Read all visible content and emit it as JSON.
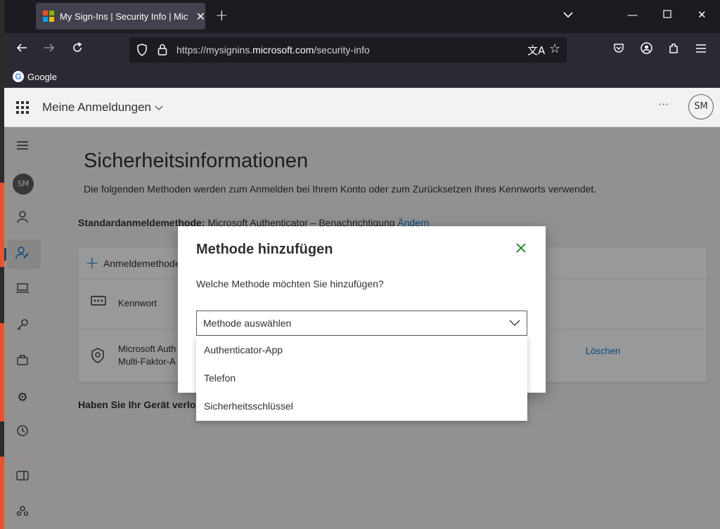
{
  "browser": {
    "tab_title": "My Sign-Ins | Security Info | Mic",
    "url_prefix": "https://mysignins.",
    "url_domain": "microsoft.com",
    "url_path": "/security-info",
    "bookmark": "Google"
  },
  "app": {
    "title": "Meine Anmeldungen",
    "avatar_initials": "SM",
    "more": "···"
  },
  "page": {
    "heading": "Sicherheitsinformationen",
    "description": "Die folgenden Methoden werden zum Anmelden bei Ihrem Konto oder zum Zurücksetzen Ihres Kennworts verwendet.",
    "default_label": "Standardanmeldemethode:",
    "default_value": " Microsoft Authenticator – Benachrichtigung ",
    "change_link": "Ändern",
    "add_method": "Anmeldemethode",
    "methods": [
      {
        "icon": "password-icon",
        "label": "Kennwort"
      },
      {
        "icon": "authenticator-icon",
        "label_line1": "Microsoft Auth",
        "label_line2": "Multi-Faktor-A"
      }
    ],
    "delete": "Löschen",
    "lost_device": "Haben Sie Ihr Gerät verlo"
  },
  "dialog": {
    "title": "Methode hinzufügen",
    "question": "Welche Methode möchten Sie hinzufügen?",
    "select_placeholder": "Methode auswählen",
    "options": [
      "Authenticator-App",
      "Telefon",
      "Sicherheitsschlüssel"
    ]
  },
  "colors": {
    "accent": "#0078d4",
    "close_green": "#107c10"
  }
}
